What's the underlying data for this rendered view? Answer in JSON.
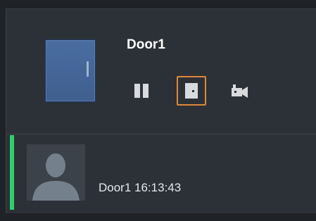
{
  "door": {
    "name": "Door1",
    "thumbnail_icon": "door-icon"
  },
  "actions": [
    {
      "name": "open-door-icon",
      "selected": false
    },
    {
      "name": "close-door-icon",
      "selected": true
    },
    {
      "name": "camera-icon",
      "selected": false
    }
  ],
  "event": {
    "text": "Door1 16:13:43",
    "status_color": "#2fd06a",
    "avatar_icon": "person-icon"
  },
  "colors": {
    "accent": "#e0883a",
    "background": "#2c3137"
  }
}
